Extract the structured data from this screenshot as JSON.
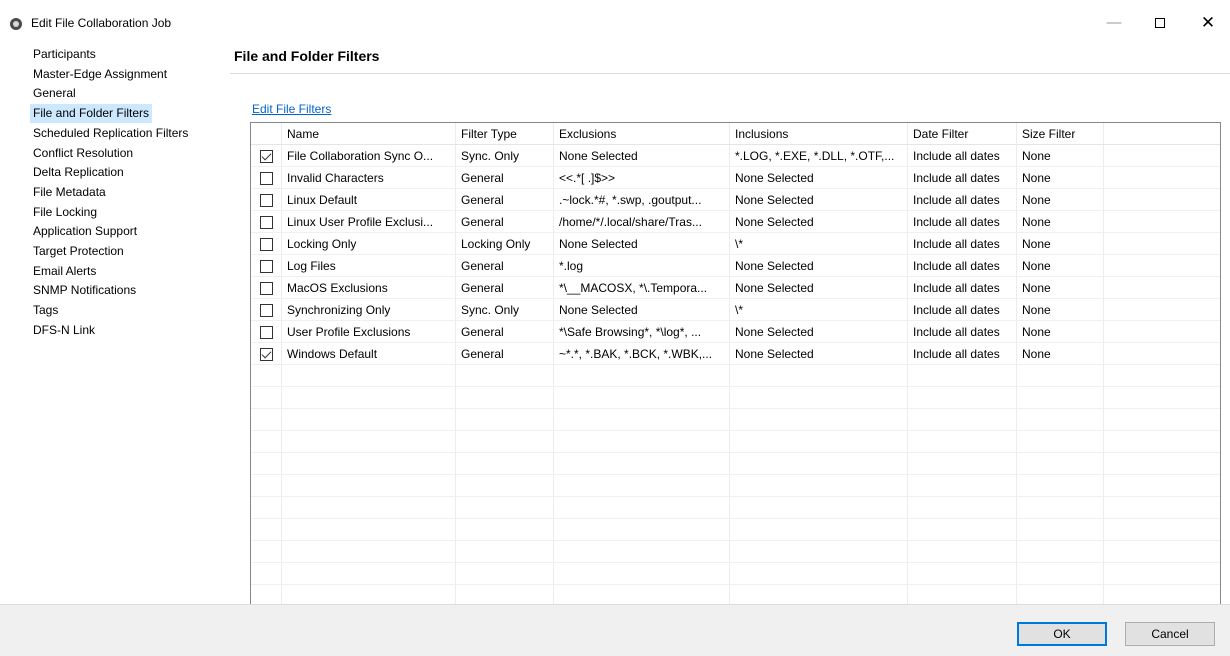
{
  "window": {
    "title": "Edit File Collaboration Job"
  },
  "nav": {
    "items": [
      "Participants",
      "Master-Edge Assignment",
      "General",
      "File and Folder Filters",
      "Scheduled Replication Filters",
      "Conflict Resolution",
      "Delta Replication",
      "File Metadata",
      "File Locking",
      "Application Support",
      "Target Protection",
      "Email Alerts",
      "SNMP Notifications",
      "Tags",
      "DFS-N Link"
    ],
    "selected": "File and Folder Filters"
  },
  "main": {
    "title": "File and Folder Filters",
    "edit_link": "Edit File Filters",
    "table": {
      "headers": [
        "Name",
        "Filter Type",
        "Exclusions",
        "Inclusions",
        "Date Filter",
        "Size Filter"
      ],
      "rows": [
        {
          "checked": true,
          "name": "File Collaboration Sync O...",
          "type": "Sync. Only",
          "exclusions": "None Selected",
          "inclusions": "*.LOG, *.EXE, *.DLL, *.OTF,...",
          "date": "Include all dates",
          "size": "None"
        },
        {
          "checked": false,
          "name": "Invalid Characters",
          "type": "General",
          "exclusions": "<<.*[ .]$>>",
          "inclusions": "None Selected",
          "date": "Include all dates",
          "size": "None"
        },
        {
          "checked": false,
          "name": "Linux Default",
          "type": "General",
          "exclusions": ".~lock.*#, *.swp, .goutput...",
          "inclusions": "None Selected",
          "date": "Include all dates",
          "size": "None"
        },
        {
          "checked": false,
          "name": "Linux User Profile Exclusi...",
          "type": "General",
          "exclusions": "/home/*/.local/share/Tras...",
          "inclusions": "None Selected",
          "date": "Include all dates",
          "size": "None"
        },
        {
          "checked": false,
          "name": "Locking Only",
          "type": "Locking Only",
          "exclusions": "None Selected",
          "inclusions": "\\*",
          "date": "Include all dates",
          "size": "None"
        },
        {
          "checked": false,
          "name": "Log Files",
          "type": "General",
          "exclusions": "*.log",
          "inclusions": "None Selected",
          "date": "Include all dates",
          "size": "None"
        },
        {
          "checked": false,
          "name": "MacOS Exclusions",
          "type": "General",
          "exclusions": "*\\__MACOSX, *\\.Tempora...",
          "inclusions": "None Selected",
          "date": "Include all dates",
          "size": "None"
        },
        {
          "checked": false,
          "name": "Synchronizing Only",
          "type": "Sync. Only",
          "exclusions": "None Selected",
          "inclusions": "\\*",
          "date": "Include all dates",
          "size": "None"
        },
        {
          "checked": false,
          "name": "User Profile Exclusions",
          "type": "General",
          "exclusions": "*\\Safe Browsing*, *\\log*, ...",
          "inclusions": "None Selected",
          "date": "Include all dates",
          "size": "None"
        },
        {
          "checked": true,
          "name": "Windows Default",
          "type": "General",
          "exclusions": "~*.*, *.BAK, *.BCK, *.WBK,...",
          "inclusions": "None Selected",
          "date": "Include all dates",
          "size": "None"
        }
      ]
    }
  },
  "footer": {
    "ok_label": "OK",
    "cancel_label": "Cancel"
  }
}
